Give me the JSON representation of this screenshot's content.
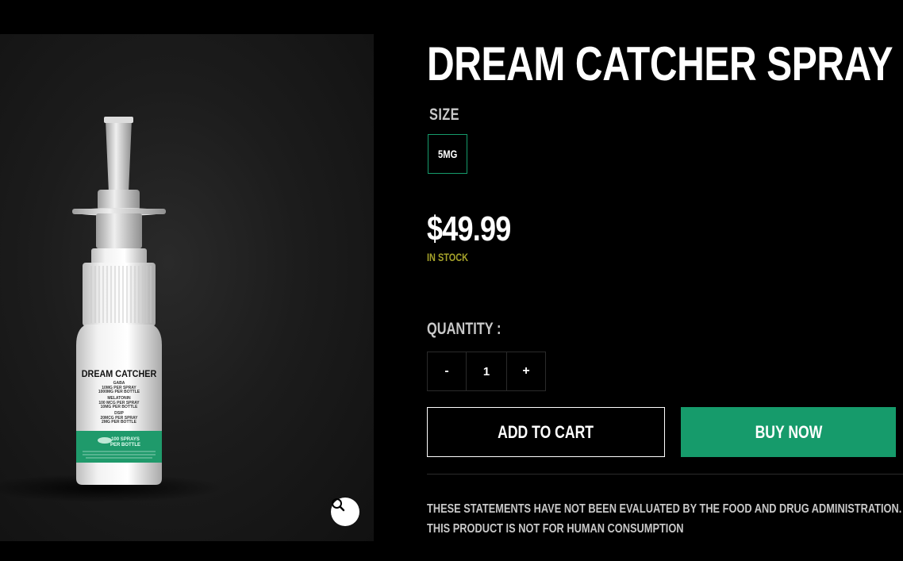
{
  "product": {
    "title": "DREAM CATCHER SPRAY",
    "size_label": "SIZE",
    "sizes": [
      "5MG"
    ],
    "selected_size": "5MG",
    "price": "$49.99",
    "stock_status": "IN STOCK"
  },
  "quantity": {
    "label": "QUANTITY :",
    "minus": "-",
    "value": "1",
    "plus": "+"
  },
  "buttons": {
    "add_to_cart": "ADD TO CART",
    "buy_now": "BUY NOW"
  },
  "disclaimer": "THESE STATEMENTS HAVE NOT BEEN EVALUATED BY THE FOOD AND DRUG ADMINISTRATION. THIS PRODUCT IS NOT FOR HUMAN CONSUMPTION",
  "bottle_label": {
    "brand": "DREAM CATCHER",
    "ingredients": [
      "GABA",
      "10MG PER SPRAY",
      "1000MG PER BOTTLE",
      "MELATONIN",
      "100 MCG PER SPRAY",
      "10MG PER BOTTLE",
      "DSIP",
      "20MCG PER SPRAY",
      "2MG PER BOTTLE"
    ],
    "band_text": "100 SPRAYS PER BOTTLE"
  },
  "colors": {
    "accent_green": "#169b6b",
    "stock_color": "#a5a22a",
    "background": "#000000"
  },
  "icons": {
    "zoom": "magnifier-icon"
  }
}
